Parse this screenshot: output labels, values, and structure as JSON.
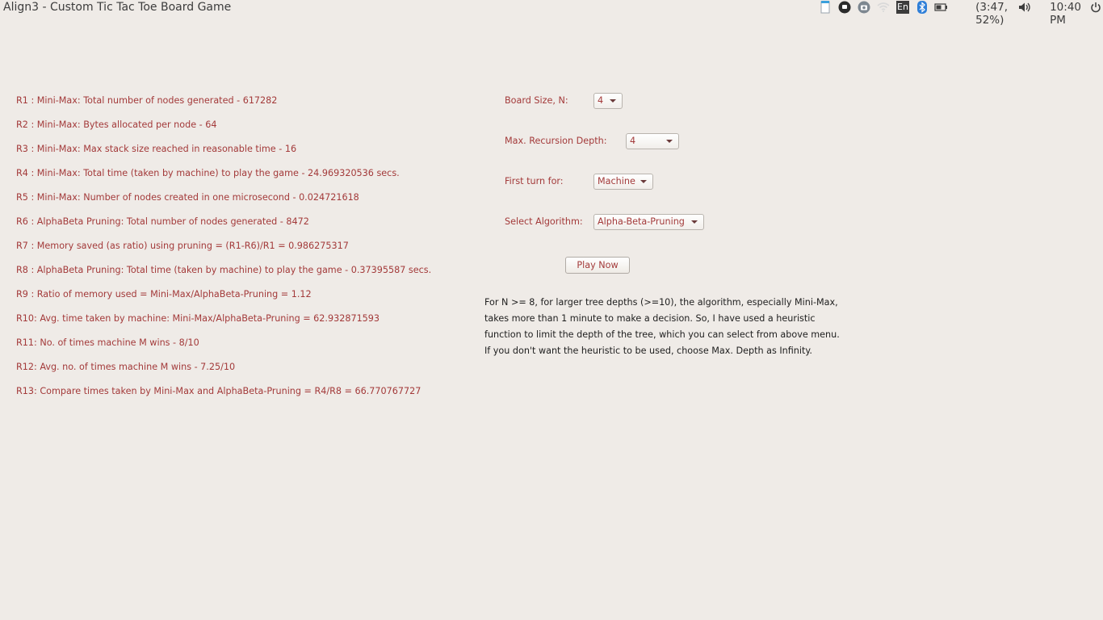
{
  "window": {
    "title": "Align3 - Custom Tic Tac Toe Board Game"
  },
  "tray": {
    "keyboard_layout": "En",
    "battery_text": "(3:47, 52%)",
    "clock": "10:40 PM",
    "icons": [
      "clipboard-icon",
      "app-indicator-icon",
      "camera-icon",
      "wifi-icon",
      "keyboard-layout-icon",
      "bluetooth-icon",
      "battery-icon",
      "volume-icon",
      "power-icon"
    ]
  },
  "results": [
    "R1 : Mini-Max: Total number of nodes generated - 617282",
    "R2 : Mini-Max: Bytes allocated per node - 64",
    "R3 : Mini-Max: Max stack size reached in reasonable time - 16",
    "R4 : Mini-Max: Total time (taken by machine) to play the game - 24.969320536 secs.",
    "R5 : Mini-Max: Number of nodes created in one microsecond - 0.024721618",
    "R6 : AlphaBeta Pruning: Total number of nodes generated - 8472",
    "R7 : Memory saved (as ratio) using pruning = (R1-R6)/R1 = 0.986275317",
    "R8 : AlphaBeta Pruning: Total time (taken by machine) to play the game - 0.37395587 secs.",
    "R9 : Ratio of memory used = Mini-Max/AlphaBeta-Pruning =  1.12",
    "R10: Avg. time taken by machine: Mini-Max/AlphaBeta-Pruning = 62.932871593",
    "R11: No. of times machine M wins - 8/10",
    "R12: Avg. no. of times machine M wins - 7.25/10",
    "R13: Compare times taken by Mini-Max and AlphaBeta-Pruning = R4/R8 = 66.770767727"
  ],
  "form": {
    "board_size": {
      "label": "Board Size, N:",
      "value": "4"
    },
    "max_depth": {
      "label": "Max. Recursion Depth:",
      "value": "4"
    },
    "first_turn": {
      "label": "First turn for:",
      "value": "Machine"
    },
    "algorithm": {
      "label": "Select Algorithm:",
      "value": "Alpha-Beta-Pruning"
    },
    "play_button": "Play Now"
  },
  "note": [
    "For N >= 8, for larger tree depths (>=10), the algorithm, especially Mini-Max,",
    "takes more than 1 minute to make a decision. So, I have used a heuristic",
    "function to limit the depth of the tree, which you can select from above menu.",
    "If you don't want the heuristic to be used, choose Max. Depth as Infinity."
  ],
  "colors": {
    "background": "#efebe7",
    "text_accent": "#a33a3a",
    "text_body": "#1e1e1e"
  }
}
